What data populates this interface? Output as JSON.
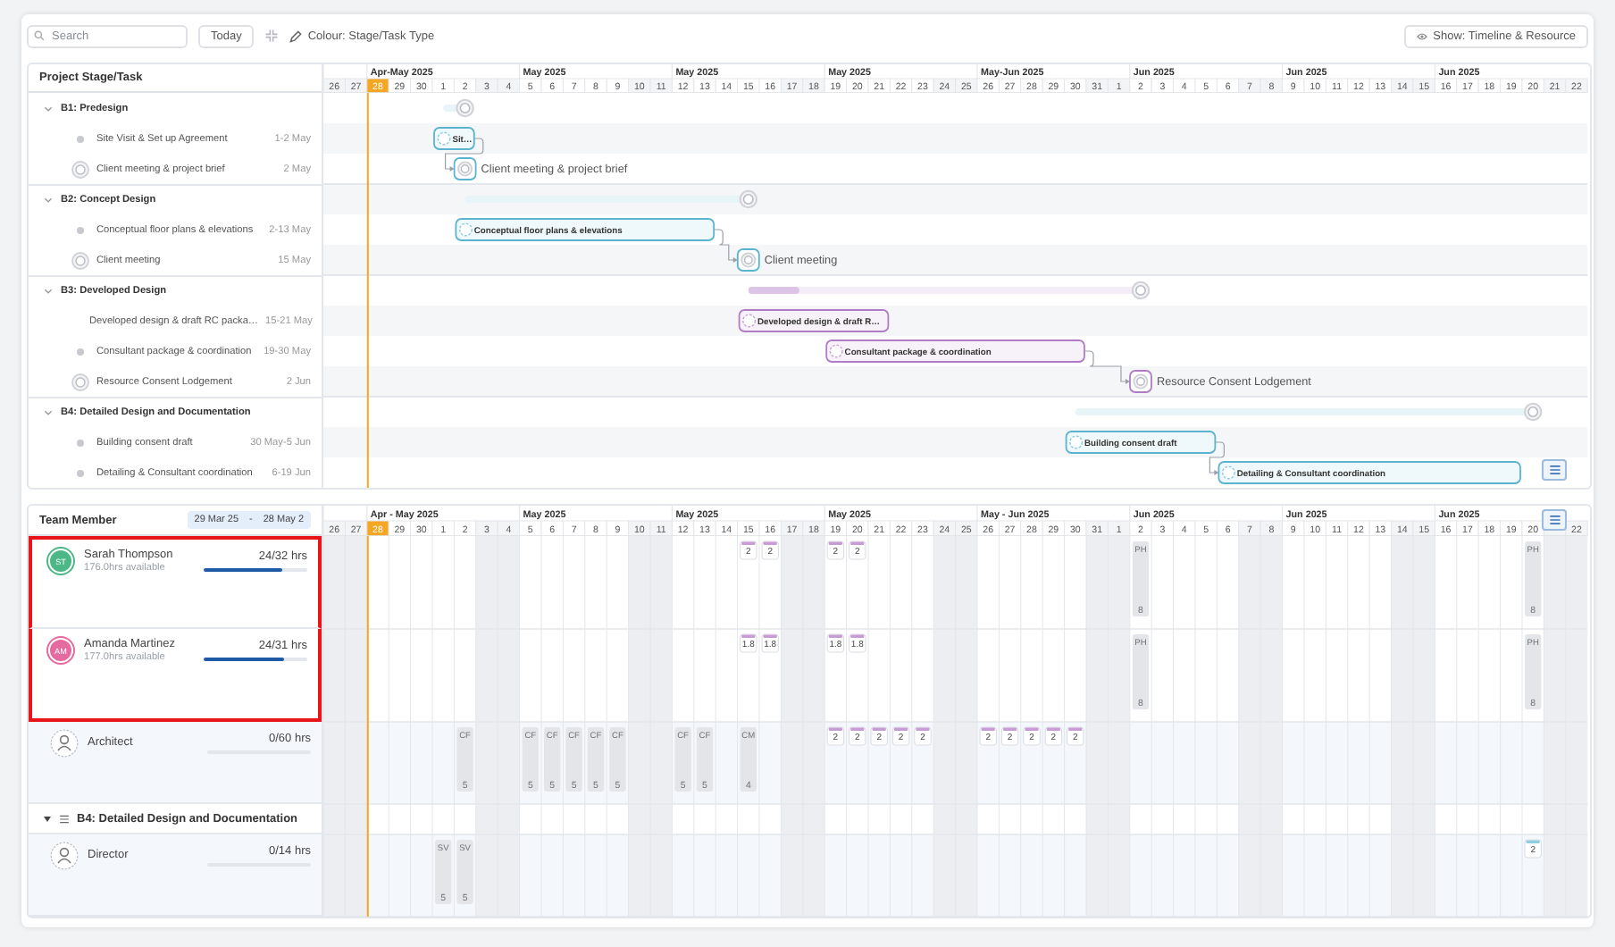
{
  "toolbar": {
    "search": {
      "placeholder": "Search"
    },
    "today_button": "Today",
    "colour_button": "Colour: Stage/Task Type",
    "show_button": "Show: Timeline & Resource"
  },
  "schedule": {
    "heading": "Project Stage/Task",
    "timeline": {
      "weeks": [
        {
          "days": [
            {
              "d": "26",
              "weekend": true,
              "today": false
            },
            {
              "d": "27",
              "weekend": true,
              "today": false
            }
          ]
        },
        {
          "label": "Apr-May 2025",
          "days": [
            {
              "d": "28",
              "weekend": false,
              "today": true
            },
            {
              "d": "29",
              "weekend": false,
              "today": false
            },
            {
              "d": "30",
              "weekend": false,
              "today": false
            },
            {
              "d": "1",
              "weekend": false,
              "today": false
            },
            {
              "d": "2",
              "weekend": false,
              "today": false
            },
            {
              "d": "3",
              "weekend": true,
              "today": false
            },
            {
              "d": "4",
              "weekend": true,
              "today": false
            }
          ]
        },
        {
          "label": "May 2025",
          "days": [
            {
              "d": "5",
              "weekend": false,
              "today": false
            },
            {
              "d": "6",
              "weekend": false,
              "today": false
            },
            {
              "d": "7",
              "weekend": false,
              "today": false
            },
            {
              "d": "8",
              "weekend": false,
              "today": false
            },
            {
              "d": "9",
              "weekend": false,
              "today": false
            },
            {
              "d": "10",
              "weekend": true,
              "today": false
            },
            {
              "d": "11",
              "weekend": true,
              "today": false
            }
          ]
        },
        {
          "label": "May 2025",
          "days": [
            {
              "d": "12",
              "weekend": false,
              "today": false
            },
            {
              "d": "13",
              "weekend": false,
              "today": false
            },
            {
              "d": "14",
              "weekend": false,
              "today": false
            },
            {
              "d": "15",
              "weekend": false,
              "today": false
            },
            {
              "d": "16",
              "weekend": false,
              "today": false
            },
            {
              "d": "17",
              "weekend": true,
              "today": false
            },
            {
              "d": "18",
              "weekend": true,
              "today": false
            }
          ]
        },
        {
          "label": "May 2025",
          "days": [
            {
              "d": "19",
              "weekend": false,
              "today": false
            },
            {
              "d": "20",
              "weekend": false,
              "today": false
            },
            {
              "d": "21",
              "weekend": false,
              "today": false
            },
            {
              "d": "22",
              "weekend": false,
              "today": false
            },
            {
              "d": "23",
              "weekend": false,
              "today": false
            },
            {
              "d": "24",
              "weekend": true,
              "today": false
            },
            {
              "d": "25",
              "weekend": true,
              "today": false
            }
          ]
        },
        {
          "label": "May-Jun 2025",
          "days": [
            {
              "d": "26",
              "weekend": false,
              "today": false
            },
            {
              "d": "27",
              "weekend": false,
              "today": false
            },
            {
              "d": "28",
              "weekend": false,
              "today": false
            },
            {
              "d": "29",
              "weekend": false,
              "today": false
            },
            {
              "d": "30",
              "weekend": false,
              "today": false
            },
            {
              "d": "31",
              "weekend": true,
              "today": false
            },
            {
              "d": "1",
              "weekend": true,
              "today": false
            }
          ]
        },
        {
          "label": "Jun 2025",
          "days": [
            {
              "d": "2",
              "weekend": false,
              "today": false
            },
            {
              "d": "3",
              "weekend": false,
              "today": false
            },
            {
              "d": "4",
              "weekend": false,
              "today": false
            },
            {
              "d": "5",
              "weekend": false,
              "today": false
            },
            {
              "d": "6",
              "weekend": false,
              "today": false
            },
            {
              "d": "7",
              "weekend": true,
              "today": false
            },
            {
              "d": "8",
              "weekend": true,
              "today": false
            }
          ]
        },
        {
          "label": "Jun 2025",
          "days": [
            {
              "d": "9",
              "weekend": false,
              "today": false
            },
            {
              "d": "10",
              "weekend": false,
              "today": false
            },
            {
              "d": "11",
              "weekend": false,
              "today": false
            },
            {
              "d": "12",
              "weekend": false,
              "today": false
            },
            {
              "d": "13",
              "weekend": false,
              "today": false
            },
            {
              "d": "14",
              "weekend": true,
              "today": false
            },
            {
              "d": "15",
              "weekend": true,
              "today": false
            }
          ]
        },
        {
          "label": "Jun 2025",
          "days": [
            {
              "d": "16",
              "weekend": false,
              "today": false
            },
            {
              "d": "17",
              "weekend": false,
              "today": false
            },
            {
              "d": "18",
              "weekend": false,
              "today": false
            },
            {
              "d": "19",
              "weekend": false,
              "today": false
            },
            {
              "d": "20",
              "weekend": false,
              "today": false
            },
            {
              "d": "21",
              "weekend": true,
              "today": false
            },
            {
              "d": "22",
              "weekend": true,
              "today": false
            }
          ]
        }
      ]
    },
    "stages": [
      {
        "name": "B1: Predesign",
        "expanded": true,
        "color": "#5ab4cf",
        "tasks": [
          {
            "kind": "task",
            "name": "Site Visit & Set up Agreement",
            "dates": "1-2 May",
            "bar_label": "Sit…",
            "linked": false
          },
          {
            "kind": "milestone",
            "name": "Client meeting & project brief",
            "dates": "2 May",
            "bar_label": "Client meeting & project brief",
            "linked": true
          }
        ]
      },
      {
        "name": "B2: Concept Design",
        "expanded": true,
        "color": "#5ab4cf",
        "tasks": [
          {
            "kind": "task",
            "name": "Conceptual floor plans & elevations",
            "dates": "2-13 May",
            "bar_label": "Conceptual floor plans & elevations",
            "linked": false
          },
          {
            "kind": "milestone",
            "name": "Client meeting",
            "dates": "15 May",
            "bar_label": "Client meeting",
            "linked": true
          }
        ]
      },
      {
        "name": "B3: Developed Design",
        "expanded": true,
        "color": "#b07cc6",
        "level": 0.13,
        "tasks": [
          {
            "kind": "task",
            "name": "Developed design & draft RC packa…",
            "dates": "15-21 May",
            "bar_label": "Developed design & draft R…",
            "linked": false
          },
          {
            "kind": "task",
            "name": "Consultant package & coordination",
            "dates": "19-30 May",
            "bar_label": "Consultant package & coordination",
            "linked": false
          },
          {
            "kind": "milestone",
            "name": "Resource Consent Lodgement",
            "dates": "2 Jun",
            "bar_label": "Resource Consent Lodgement",
            "linked": true
          }
        ]
      },
      {
        "name": "B4: Detailed Design and Documentation",
        "expanded": true,
        "color": "#5ab4cf",
        "tasks": [
          {
            "kind": "task",
            "name": "Building consent draft",
            "dates": "30 May-5 Jun",
            "bar_label": "Building consent draft",
            "linked": false
          },
          {
            "kind": "task",
            "name": "Detailing & Consultant coordination",
            "dates": "6-19 Jun",
            "bar_label": "Detailing & Consultant coordination",
            "linked": true
          }
        ]
      }
    ]
  },
  "resources": {
    "heading": "Team Member",
    "range_from": "29 Mar 25",
    "range_separator": "-",
    "range_to": "28 May 2",
    "timeline": {
      "weeks": [
        {
          "days": [
            {
              "d": "26",
              "weekend": true,
              "today": false
            },
            {
              "d": "27",
              "weekend": true,
              "today": false
            }
          ]
        },
        {
          "label": "Apr - May 2025",
          "days": [
            {
              "d": "28",
              "weekend": false,
              "today": true
            },
            {
              "d": "29",
              "weekend": false,
              "today": false
            },
            {
              "d": "30",
              "weekend": false,
              "today": false
            },
            {
              "d": "1",
              "weekend": false,
              "today": false
            },
            {
              "d": "2",
              "weekend": false,
              "today": false
            },
            {
              "d": "3",
              "weekend": true,
              "today": false
            },
            {
              "d": "4",
              "weekend": true,
              "today": false
            }
          ]
        },
        {
          "label": "May 2025",
          "days": [
            {
              "d": "5",
              "weekend": false,
              "today": false
            },
            {
              "d": "6",
              "weekend": false,
              "today": false
            },
            {
              "d": "7",
              "weekend": false,
              "today": false
            },
            {
              "d": "8",
              "weekend": false,
              "today": false
            },
            {
              "d": "9",
              "weekend": false,
              "today": false
            },
            {
              "d": "10",
              "weekend": true,
              "today": false
            },
            {
              "d": "11",
              "weekend": true,
              "today": false
            }
          ]
        },
        {
          "label": "May 2025",
          "days": [
            {
              "d": "12",
              "weekend": false,
              "today": false
            },
            {
              "d": "13",
              "weekend": false,
              "today": false
            },
            {
              "d": "14",
              "weekend": false,
              "today": false
            },
            {
              "d": "15",
              "weekend": false,
              "today": false
            },
            {
              "d": "16",
              "weekend": false,
              "today": false
            },
            {
              "d": "17",
              "weekend": true,
              "today": false
            },
            {
              "d": "18",
              "weekend": true,
              "today": false
            }
          ]
        },
        {
          "label": "May 2025",
          "days": [
            {
              "d": "19",
              "weekend": false,
              "today": false
            },
            {
              "d": "20",
              "weekend": false,
              "today": false
            },
            {
              "d": "21",
              "weekend": false,
              "today": false
            },
            {
              "d": "22",
              "weekend": false,
              "today": false
            },
            {
              "d": "23",
              "weekend": false,
              "today": false
            },
            {
              "d": "24",
              "weekend": true,
              "today": false
            },
            {
              "d": "25",
              "weekend": true,
              "today": false
            }
          ]
        },
        {
          "label": "May - Jun 2025",
          "days": [
            {
              "d": "26",
              "weekend": false,
              "today": false
            },
            {
              "d": "27",
              "weekend": false,
              "today": false
            },
            {
              "d": "28",
              "weekend": false,
              "today": false
            },
            {
              "d": "29",
              "weekend": false,
              "today": false
            },
            {
              "d": "30",
              "weekend": false,
              "today": false
            },
            {
              "d": "31",
              "weekend": true,
              "today": false
            },
            {
              "d": "1",
              "weekend": true,
              "today": false
            }
          ]
        },
        {
          "label": "Jun 2025",
          "days": [
            {
              "d": "2",
              "weekend": false,
              "today": false
            },
            {
              "d": "3",
              "weekend": false,
              "today": false
            },
            {
              "d": "4",
              "weekend": false,
              "today": false
            },
            {
              "d": "5",
              "weekend": false,
              "today": false
            },
            {
              "d": "6",
              "weekend": false,
              "today": false
            },
            {
              "d": "7",
              "weekend": true,
              "today": false
            },
            {
              "d": "8",
              "weekend": true,
              "today": false
            }
          ]
        },
        {
          "label": "Jun 2025",
          "days": [
            {
              "d": "9",
              "weekend": false,
              "today": false
            },
            {
              "d": "10",
              "weekend": false,
              "today": false
            },
            {
              "d": "11",
              "weekend": false,
              "today": false
            },
            {
              "d": "12",
              "weekend": false,
              "today": false
            },
            {
              "d": "13",
              "weekend": false,
              "today": false
            },
            {
              "d": "14",
              "weekend": true,
              "today": false
            },
            {
              "d": "15",
              "weekend": true,
              "today": false
            }
          ]
        },
        {
          "label": "Jun 2025",
          "days": [
            {
              "d": "16",
              "weekend": false,
              "today": false
            },
            {
              "d": "17",
              "weekend": false,
              "today": false
            },
            {
              "d": "18",
              "weekend": false,
              "today": false
            },
            {
              "d": "19",
              "weekend": false,
              "today": false
            },
            {
              "d": "20",
              "weekend": false,
              "today": false
            },
            {
              "weekend": true,
              "today": false
            },
            {
              "d": "22",
              "weekend": true,
              "today": false
            }
          ]
        }
      ]
    },
    "rows": [
      {
        "kind": "person",
        "name": "Sarah Thompson",
        "initials": "ST",
        "color": "#4db887",
        "available": "176.0hrs available",
        "hours": "24/32 hrs",
        "level": 0.75,
        "highlighted": true,
        "cells": [
          [
            null,
            null
          ],
          [
            null,
            null,
            null,
            null,
            null,
            null,
            null
          ],
          [
            null,
            null,
            null,
            null,
            null,
            null,
            null
          ],
          [
            null,
            null,
            null,
            {
              "kind": "hours",
              "value": "2",
              "color": "#c79bd3"
            },
            {
              "kind": "hours",
              "value": "2",
              "color": "#c79bd3"
            },
            null,
            null
          ],
          [
            {
              "kind": "hours",
              "value": "2",
              "color": "#c79bd3"
            },
            {
              "kind": "hours",
              "value": "2",
              "color": "#c79bd3"
            },
            null,
            null,
            null,
            null,
            null
          ],
          [
            null,
            null,
            null,
            null,
            null,
            null,
            null
          ],
          [
            {
              "kind": "block",
              "code": "PH",
              "value": "8"
            },
            null,
            null,
            null,
            null,
            null,
            null
          ],
          [
            null,
            null,
            null,
            null,
            null,
            null,
            null
          ],
          [
            null,
            null,
            null,
            null,
            {
              "kind": "block",
              "code": "PH",
              "value": "8"
            },
            null,
            null
          ]
        ]
      },
      {
        "kind": "person",
        "name": "Amanda Martinez",
        "initials": "AM",
        "color": "#e46aa0",
        "available": "177.0hrs available",
        "hours": "24/31 hrs",
        "level": 0.77,
        "highlighted": true,
        "cells": [
          [
            null,
            null
          ],
          [
            null,
            null,
            null,
            null,
            null,
            null,
            null
          ],
          [
            null,
            null,
            null,
            null,
            null,
            null,
            null
          ],
          [
            null,
            null,
            null,
            {
              "kind": "hours",
              "value": "1.8",
              "color": "#c79bd3"
            },
            {
              "kind": "hours",
              "value": "1.8",
              "color": "#c79bd3"
            },
            null,
            null
          ],
          [
            {
              "kind": "hours",
              "value": "1.8",
              "color": "#c79bd3"
            },
            {
              "kind": "hours",
              "value": "1.8",
              "color": "#c79bd3"
            },
            null,
            null,
            null,
            null,
            null
          ],
          [
            null,
            null,
            null,
            null,
            null,
            null,
            null
          ],
          [
            {
              "kind": "block",
              "code": "PH",
              "value": "8"
            },
            null,
            null,
            null,
            null,
            null,
            null
          ],
          [
            null,
            null,
            null,
            null,
            null,
            null,
            null
          ],
          [
            null,
            null,
            null,
            null,
            {
              "kind": "block",
              "code": "PH",
              "value": "8"
            },
            null,
            null
          ]
        ]
      },
      {
        "kind": "role",
        "name": "Architect",
        "hours": "0/60 hrs",
        "highlighted": false,
        "cells": [
          [
            null,
            null
          ],
          [
            null,
            null,
            null,
            null,
            {
              "kind": "block",
              "code": "CF",
              "value": "5"
            },
            null,
            null
          ],
          [
            {
              "kind": "block",
              "code": "CF",
              "value": "5"
            },
            {
              "kind": "block",
              "code": "CF",
              "value": "5"
            },
            {
              "kind": "block",
              "code": "CF",
              "value": "5"
            },
            {
              "kind": "block",
              "code": "CF",
              "value": "5"
            },
            {
              "kind": "block",
              "code": "CF",
              "value": "5"
            },
            null,
            null
          ],
          [
            {
              "kind": "block",
              "code": "CF",
              "value": "5"
            },
            {
              "kind": "block",
              "code": "CF",
              "value": "5"
            },
            null,
            {
              "kind": "block",
              "code": "CM",
              "value": "4"
            },
            null,
            null,
            null
          ],
          [
            {
              "kind": "hours",
              "value": "2",
              "color": "#c79bd3"
            },
            {
              "kind": "hours",
              "value": "2",
              "color": "#c79bd3"
            },
            {
              "kind": "hours",
              "value": "2",
              "color": "#c79bd3"
            },
            {
              "kind": "hours",
              "value": "2",
              "color": "#c79bd3"
            },
            {
              "kind": "hours",
              "value": "2",
              "color": "#c79bd3"
            },
            null,
            null
          ],
          [
            {
              "kind": "hours",
              "value": "2",
              "color": "#c79bd3"
            },
            {
              "kind": "hours",
              "value": "2",
              "color": "#c79bd3"
            },
            {
              "kind": "hours",
              "value": "2",
              "color": "#c79bd3"
            },
            {
              "kind": "hours",
              "value": "2",
              "color": "#c79bd3"
            },
            {
              "kind": "hours",
              "value": "2",
              "color": "#c79bd3"
            },
            null,
            null
          ],
          [
            null,
            null,
            null,
            null,
            null,
            null,
            null
          ],
          [
            null,
            null,
            null,
            null,
            null,
            null,
            null
          ],
          [
            null,
            null,
            null,
            null,
            null,
            null,
            null
          ]
        ]
      },
      {
        "kind": "group",
        "name": "B4: Detailed Design and Documentation",
        "expanded": true
      },
      {
        "kind": "role",
        "name": "Director",
        "hours": "0/14 hrs",
        "highlighted": false,
        "cells": [
          [
            null,
            null
          ],
          [
            null,
            null,
            null,
            {
              "kind": "block",
              "code": "SV",
              "value": "5"
            },
            {
              "kind": "block",
              "code": "SV",
              "value": "5"
            },
            null,
            null
          ],
          [
            null,
            null,
            null,
            null,
            null,
            null,
            null
          ],
          [
            null,
            null,
            null,
            null,
            null,
            null,
            null
          ],
          [
            null,
            null,
            null,
            null,
            null,
            null,
            null
          ],
          [
            null,
            null,
            null,
            null,
            null,
            null,
            null
          ],
          [
            null,
            null,
            null,
            null,
            null,
            null,
            null
          ],
          [
            null,
            null,
            null,
            null,
            null,
            null,
            null
          ],
          [
            null,
            null,
            null,
            null,
            {
              "kind": "hours",
              "value": "2",
              "color": "#8fcde0"
            },
            null,
            null
          ]
        ]
      }
    ]
  }
}
